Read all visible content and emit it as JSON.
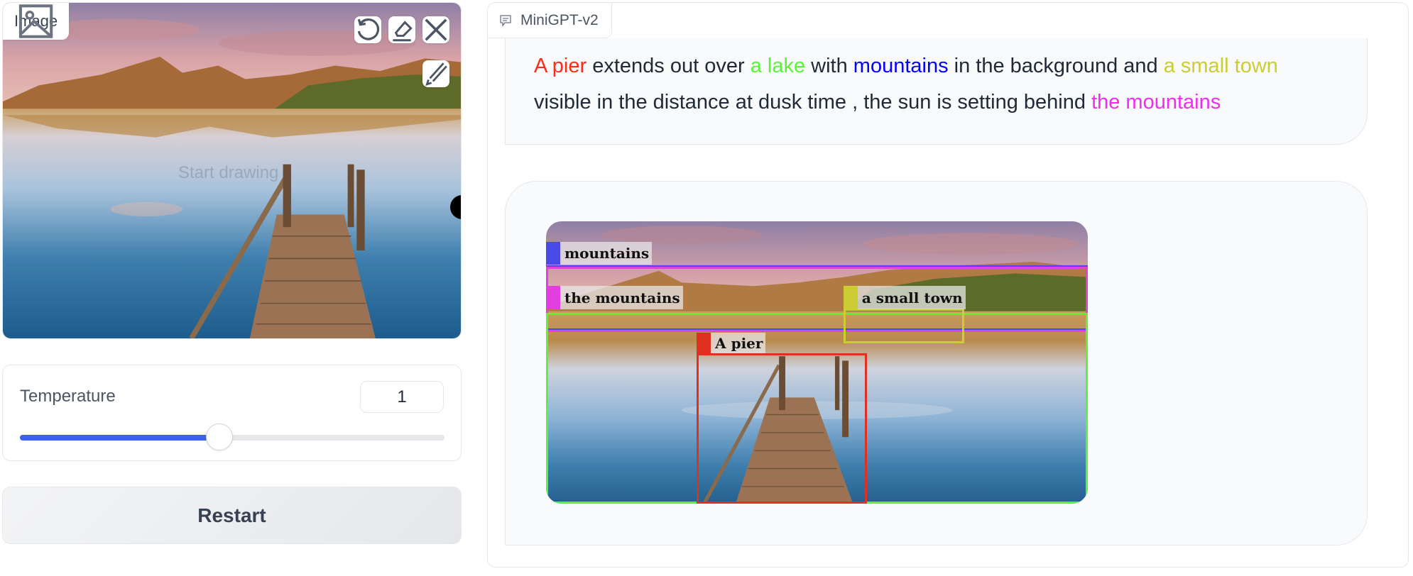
{
  "image_input": {
    "label": "Image",
    "placeholder": "Start drawing",
    "tools": [
      "undo-icon",
      "eraser-icon",
      "close-icon",
      "brush-icon"
    ]
  },
  "temperature": {
    "label": "Temperature",
    "value": "1",
    "slider_fraction": 0.47,
    "accent_color": "#3b63e3"
  },
  "restart_label": "Restart",
  "chat": {
    "label": "MiniGPT-v2",
    "response": [
      {
        "text": "A pier",
        "color": "#ff2a1a"
      },
      {
        "text": " extends out over ",
        "color": "#1f2937"
      },
      {
        "text": "a lake",
        "color": "#5cf23a"
      },
      {
        "text": " with ",
        "color": "#1f2937"
      },
      {
        "text": "mountains",
        "color": "#0000ff"
      },
      {
        "text": " in the background and ",
        "color": "#1f2937"
      },
      {
        "text": "a small town",
        "color": "#cccc33"
      },
      {
        "text": " visible in the distance at dusk time , the sun is setting behind ",
        "color": "#1f2937"
      },
      {
        "text": "the mountains",
        "color": "#f02cf0"
      }
    ],
    "annotations": [
      {
        "label": "mountains",
        "color": "#4a4ae6"
      },
      {
        "label": "the mountains",
        "color": "#e23ee2"
      },
      {
        "label": "a lake",
        "color": "#5cf23a"
      },
      {
        "label": "a small town",
        "color": "#cccc33"
      },
      {
        "label": "A pier",
        "color": "#e03020"
      }
    ]
  }
}
